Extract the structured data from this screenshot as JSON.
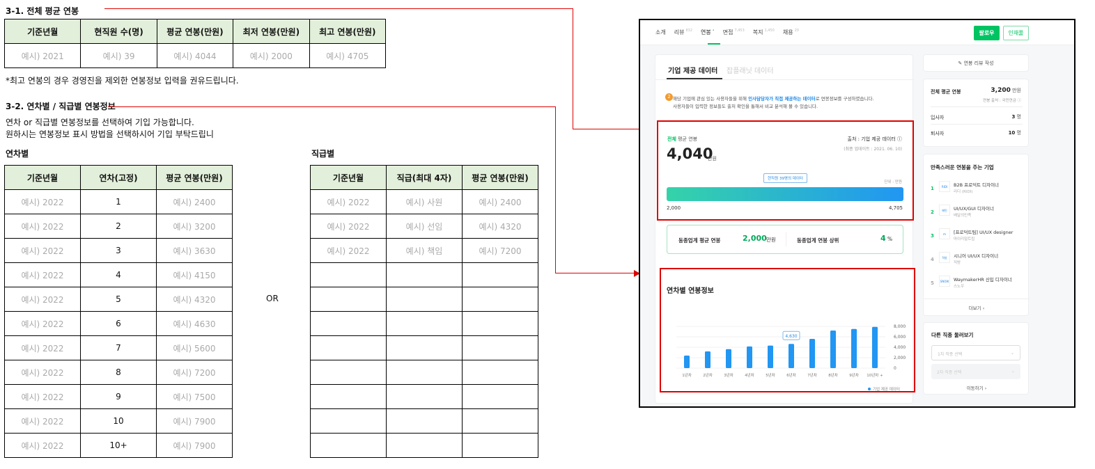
{
  "section1": {
    "title": "3-1. 전체 평균 연봉",
    "headers": [
      "기준년월",
      "현직원 수(명)",
      "평균 연봉(만원)",
      "최저 연봉(만원)",
      "최고 연봉(만원)"
    ],
    "row": [
      "예시) 2021",
      "예시) 39",
      "예시) 4044",
      "예시) 2000",
      "예시) 4705"
    ],
    "note": "*최고 연봉의 경우 경영진을 제외한 연봉정보 입력을 권유드립니다."
  },
  "section2": {
    "title": "3-2. 연차별 / 직급별 연봉정보",
    "desc1": "연차 or 직급별 연봉정보를 선택하여 기입 가능합니다.",
    "desc2": "원하시는 연봉정보 표시 방법을 선택하시어 기입 부탁드립니",
    "or": "OR",
    "by_year": {
      "label": "연차별",
      "headers": [
        "기준년월",
        "연차(고정)",
        "평균 연봉(만원)"
      ],
      "rows": [
        [
          "예시) 2022",
          "1",
          "예시) 2400"
        ],
        [
          "예시) 2022",
          "2",
          "예시) 3200"
        ],
        [
          "예시) 2022",
          "3",
          "예시) 3630"
        ],
        [
          "예시) 2022",
          "4",
          "예시) 4150"
        ],
        [
          "예시) 2022",
          "5",
          "예시) 4320"
        ],
        [
          "예시) 2022",
          "6",
          "예시) 4630"
        ],
        [
          "예시) 2022",
          "7",
          "예시) 5600"
        ],
        [
          "예시) 2022",
          "8",
          "예시) 7200"
        ],
        [
          "예시) 2022",
          "9",
          "예시) 7500"
        ],
        [
          "예시) 2022",
          "10",
          "예시) 7900"
        ],
        [
          "예시) 2022",
          "10+",
          "예시) 7900"
        ]
      ]
    },
    "by_rank": {
      "label": "직급별",
      "headers": [
        "기준년월",
        "직급(최대 4자)",
        "평균 연봉(만원)"
      ],
      "rows": [
        [
          "예시) 2022",
          "예시) 사원",
          "예시) 2400"
        ],
        [
          "예시) 2022",
          "예시) 선임",
          "예시) 4320"
        ],
        [
          "예시) 2022",
          "예시) 책임",
          "예시) 7200"
        ],
        [
          "",
          "",
          ""
        ],
        [
          "",
          "",
          ""
        ],
        [
          "",
          "",
          ""
        ],
        [
          "",
          "",
          ""
        ],
        [
          "",
          "",
          ""
        ],
        [
          "",
          "",
          ""
        ],
        [
          "",
          "",
          ""
        ],
        [
          "",
          "",
          ""
        ]
      ]
    }
  },
  "app": {
    "accent": "#00c362",
    "nav": [
      {
        "label": "소개",
        "count": ""
      },
      {
        "label": "리뷰",
        "count": "832"
      },
      {
        "label": "연봉",
        "count": "•"
      },
      {
        "label": "면접",
        "count": "7,453"
      },
      {
        "label": "복지",
        "count": "1,450"
      },
      {
        "label": "채용",
        "count": "20"
      }
    ],
    "follow": "팔로우",
    "talent_pool": "인재풀",
    "tabs": [
      "기업 제공 데이터",
      "잡플래닛 데이터"
    ],
    "badge": "2",
    "notice_a": "해당 기업에 관심 있는 사용자들을 위해 ",
    "notice_link": "인사담당자가 직접 제공하는 데이터",
    "notice_b": "로 연봉정보를 구성하였습니다.",
    "notice_2": "사용자들이 입력한 정보들도 출처 확인을 통해서 비교 분석해 볼 수 있습니다.",
    "avg_label_hl": "전체",
    "avg_label": " 평균 연봉",
    "avg_value": "4,040",
    "unit": "만원",
    "source": "출처 : 기업 제공 데이터",
    "updated": "(최종 업데이트 : 2021. 06. 10)",
    "tooltip": "현직원 39명의 데이터",
    "unit_note": "단위 : 만원",
    "range_min": "2,000",
    "range_max": "4,705",
    "industry_avg_label": "동종업계 평균 연봉",
    "industry_avg": "2,000",
    "industry_rank_label": "동종업계 연봉 상위",
    "industry_rank": "4",
    "pct": "%",
    "side": {
      "write_review": "✎ 연봉 리뷰 작성",
      "total_avg_label": "전체 평균 연봉",
      "total_avg": "3,200",
      "total_avg_unit": "만원",
      "total_src": "연봉 출처 : 국민연금 ⓘ",
      "join_label": "입사자",
      "join": "3",
      "leave_label": "퇴사자",
      "leave": "10",
      "person": "명",
      "companies_title": "만족스러운 연봉을 주는 기업",
      "companies": [
        {
          "rank": "1",
          "title": "B2B 프로덕트 디자이너",
          "company": "리디 (RIDI)",
          "logo": "RIDI"
        },
        {
          "rank": "2",
          "title": "UI/UX/GUI 디자이너",
          "company": "배달의민족",
          "logo": "배민"
        },
        {
          "rank": "3",
          "title": "[프로덕트팀] UI/UX designer",
          "company": "마이리얼트립",
          "logo": "m"
        },
        {
          "rank": "4",
          "title": "시니어 UI/UX 디자이너",
          "company": "직방",
          "logo": "직방"
        },
        {
          "rank": "5",
          "title": "WaymakerHR 신입 디자이너",
          "company": "스노우",
          "logo": "SNOW"
        }
      ],
      "more": "더보기 ›",
      "other_title": "다른 직종 둘러보기",
      "select1": "1차 직종 선택",
      "select2": "2차 직종 선택",
      "go": "이동하기 ›"
    }
  },
  "chart_data": {
    "type": "bar",
    "title": "연차별 연봉정보",
    "categories": [
      "1년차",
      "2년차",
      "3년차",
      "4년차",
      "5년차",
      "6년차",
      "7년차",
      "8년차",
      "9년차",
      "10년차 +"
    ],
    "values": [
      2400,
      3200,
      3630,
      4150,
      4320,
      4630,
      5600,
      7200,
      7500,
      7900
    ],
    "ylim": [
      0,
      8000
    ],
    "yticks": [
      "8,000",
      "6,000",
      "4,000",
      "2,000",
      "0"
    ],
    "highlight": {
      "index": 5,
      "label": "4,630"
    },
    "legend": "기업 제공 데이터",
    "legend_position": "bottom-right",
    "color": "#2196f3",
    "grid": true
  }
}
